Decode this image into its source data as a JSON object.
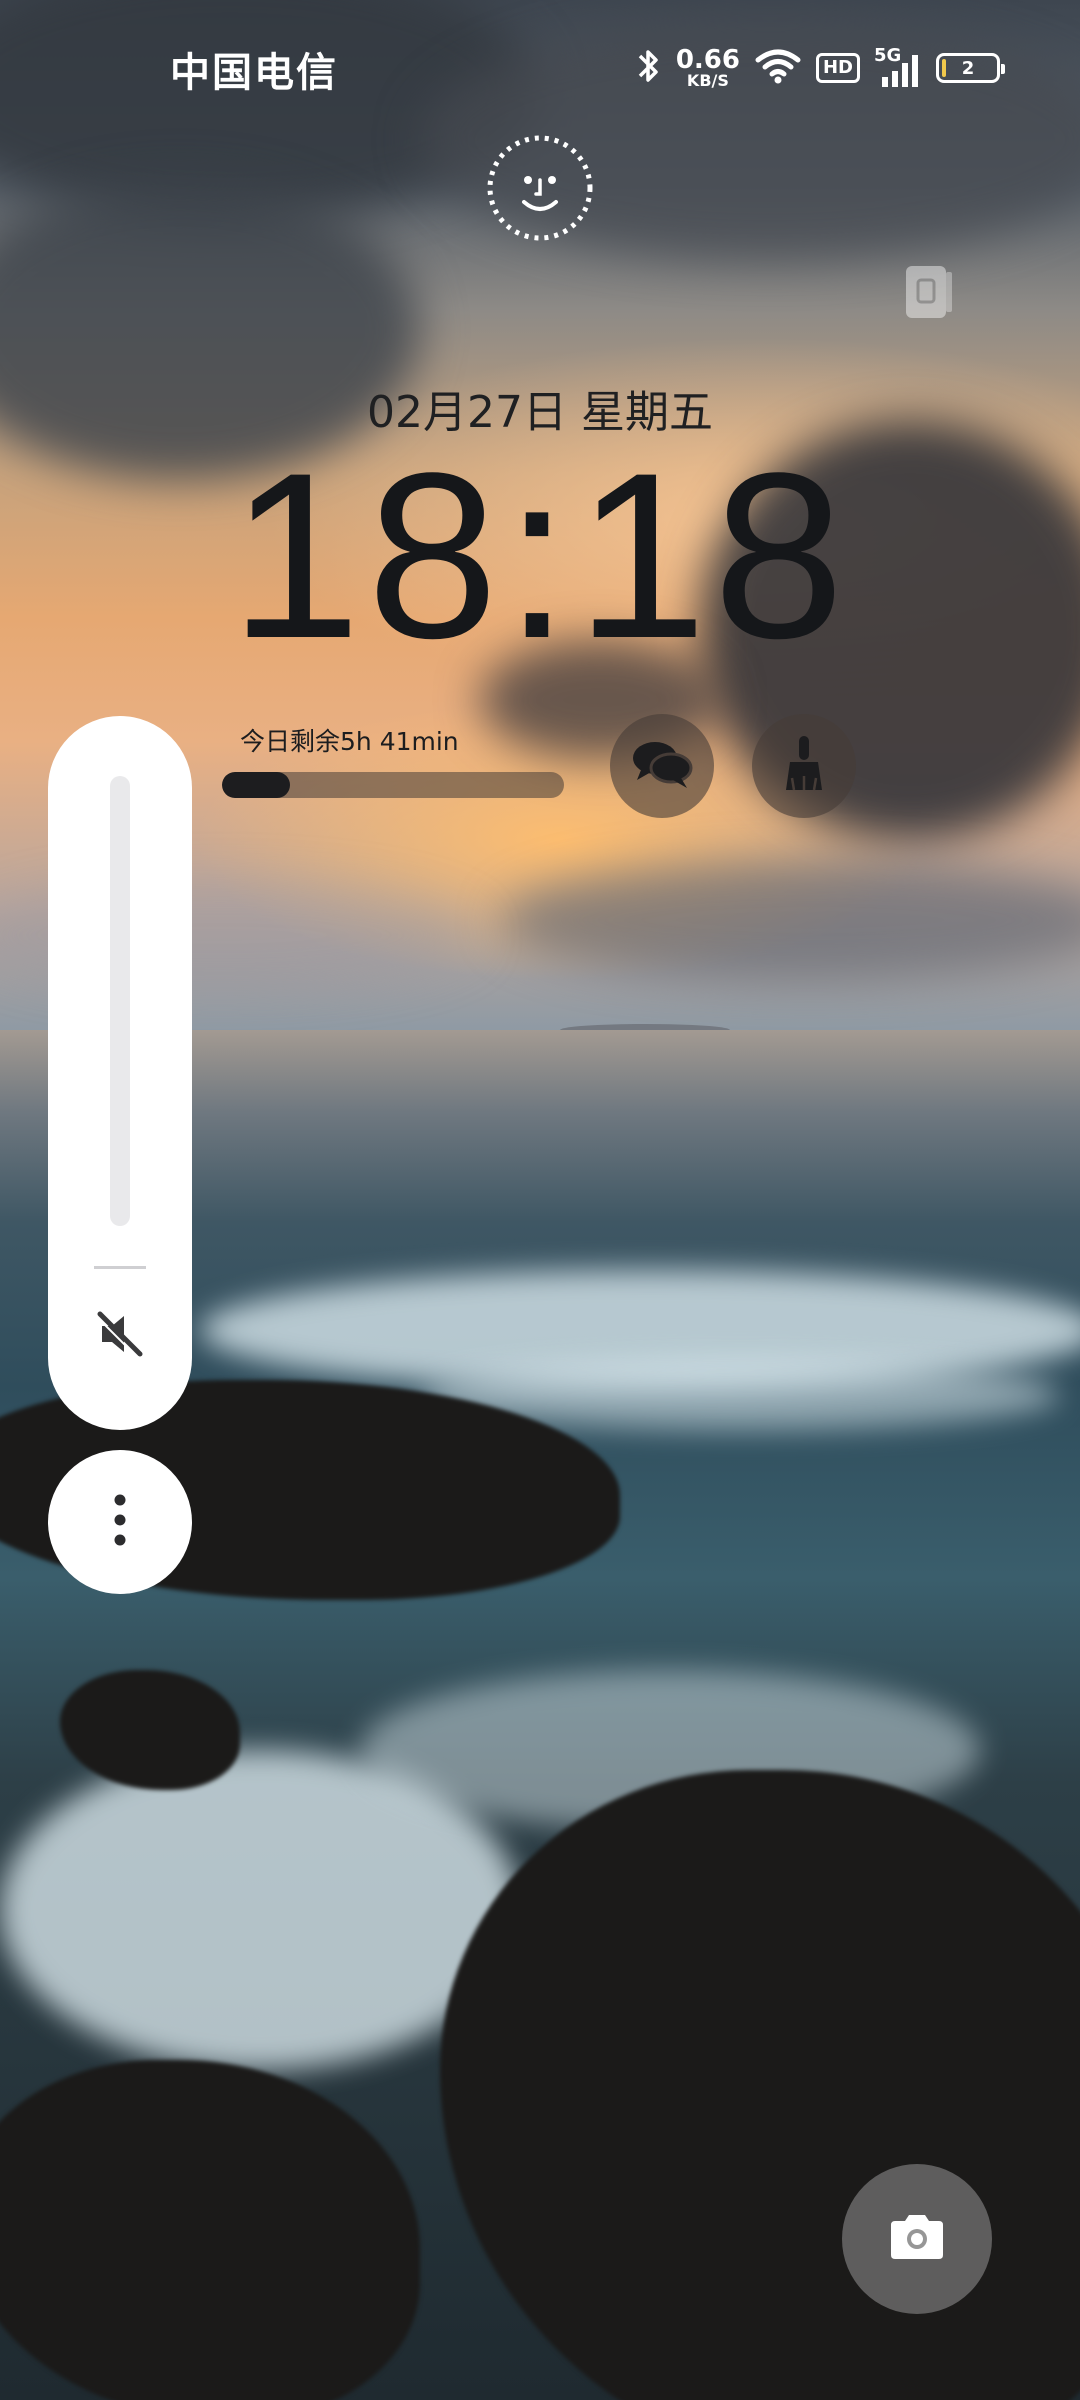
{
  "status_bar": {
    "carrier": "中国电信",
    "net_speed_value": "0.66",
    "net_speed_unit": "KB/S",
    "hd_label": "HD",
    "network_type": "5G",
    "battery_level": "2",
    "icons": [
      "bluetooth-icon",
      "wifi-icon",
      "hd-badge",
      "signal-5g-icon",
      "battery-icon"
    ]
  },
  "lockscreen": {
    "date": "02月27日  星期五",
    "time": "18:18"
  },
  "screen_time": {
    "label": "今日剩余5h 41min",
    "progress_fraction": 0.2
  },
  "shortcuts": {
    "left_icon": "chat-bubbles-icon",
    "right_icon": "broom-icon"
  },
  "volume_panel": {
    "level_fraction": 0.0,
    "mute_icon": "speaker-muted-icon",
    "more_icon": "more-vertical-icon"
  },
  "camera": {
    "icon": "camera-icon"
  },
  "colors": {
    "clock_text": "#15171a",
    "panel_bg": "#ffffff",
    "accent_progress": "#1d1d1f"
  }
}
